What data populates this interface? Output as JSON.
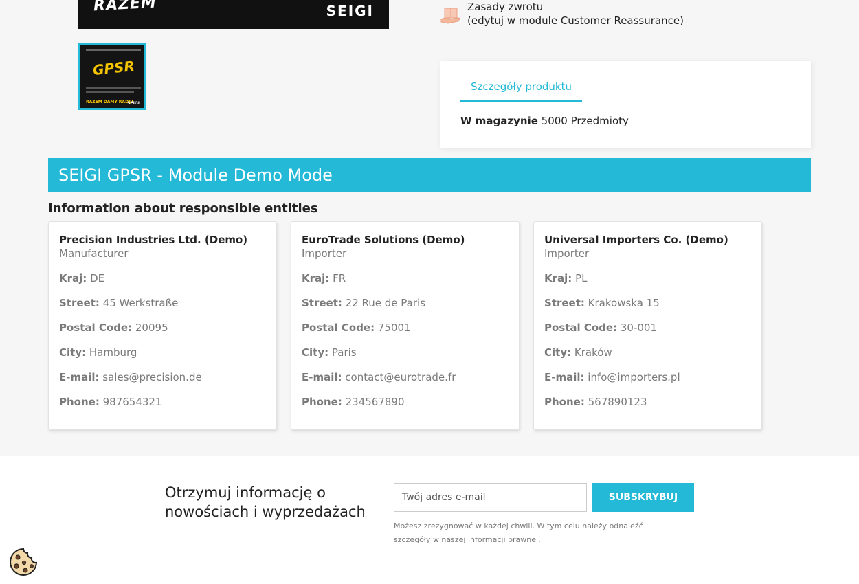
{
  "gallery": {
    "main_image_text_left": "RAZEM",
    "main_image_text_right": "SEIGI",
    "thumb_title": "GPSR",
    "thumb_footer_left": "RAZEM DAMY RADĘ!",
    "thumb_footer_right": "SEIGI"
  },
  "reassurance": {
    "line1": "Zasady zwrotu",
    "line2": "(edytuj w module Customer Reassurance)"
  },
  "tabs": {
    "active_tab": "Szczegóły produktu",
    "stock_label": "W magazynie",
    "stock_value": "5000 Przedmioty"
  },
  "gpsr": {
    "banner": "SEIGI GPSR - Module Demo Mode",
    "section_title": "Information about responsible entities",
    "labels": {
      "country": "Kraj:",
      "street": "Street:",
      "postal": "Postal Code:",
      "city": "City:",
      "email": "E-mail:",
      "phone": "Phone:"
    },
    "entities": [
      {
        "name": "Precision Industries Ltd. (Demo)",
        "role": "Manufacturer",
        "country": "DE",
        "street": "45 Werkstraße",
        "postal": "20095",
        "city": "Hamburg",
        "email": "sales@precision.de",
        "phone": "987654321"
      },
      {
        "name": "EuroTrade Solutions (Demo)",
        "role": "Importer",
        "country": "FR",
        "street": "22 Rue de Paris",
        "postal": "75001",
        "city": "Paris",
        "email": "contact@eurotrade.fr",
        "phone": "234567890"
      },
      {
        "name": "Universal Importers Co. (Demo)",
        "role": "Importer",
        "country": "PL",
        "street": "Krakowska 15",
        "postal": "30-001",
        "city": "Kraków",
        "email": "info@importers.pl",
        "phone": "567890123"
      }
    ]
  },
  "newsletter": {
    "title": "Otrzymuj informację o nowościach i wyprzedażach",
    "placeholder": "Twój adres e-mail",
    "button": "Subskrybuj",
    "note": "Możesz zrezygnować w każdej chwili. W tym celu należy odnaleźć szczegóły w naszej informacji prawnej."
  },
  "colors": {
    "accent": "#24b9d7",
    "background": "#f6f6f6"
  }
}
